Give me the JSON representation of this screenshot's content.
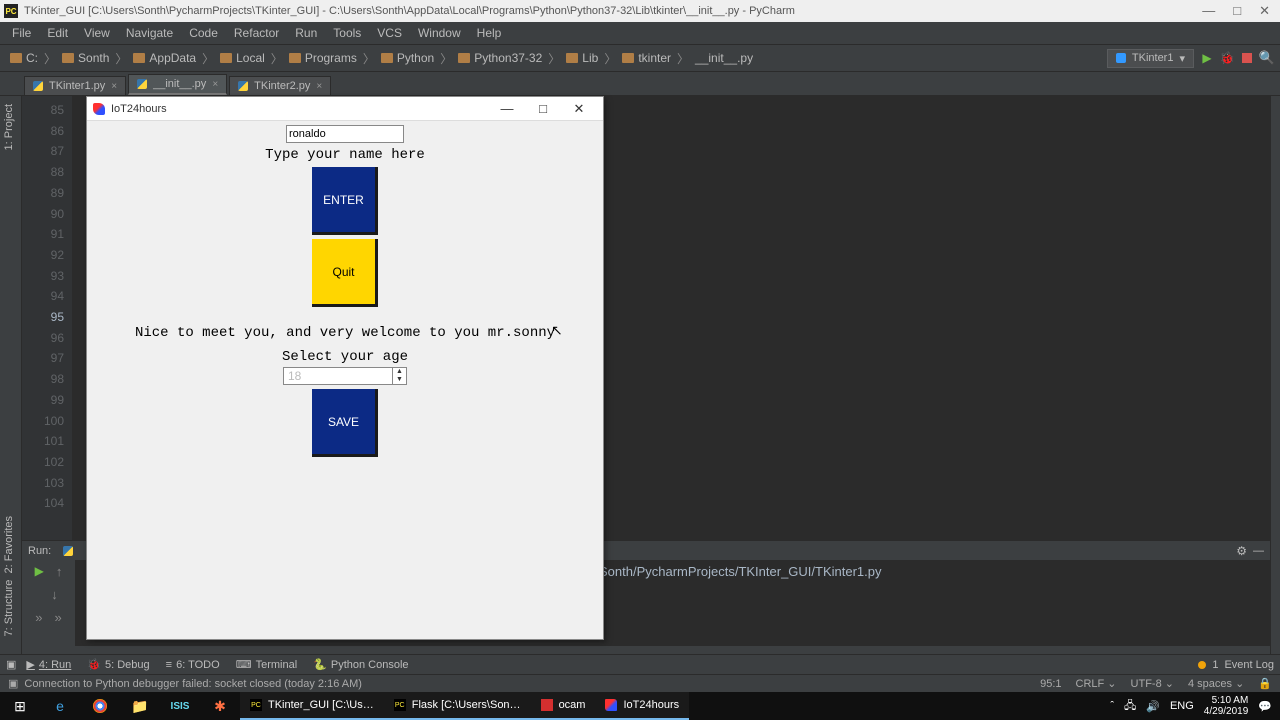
{
  "titlebar": {
    "text": "TKinter_GUI [C:\\Users\\Sonth\\PycharmProjects\\TKinter_GUI] - C:\\Users\\Sonth\\AppData\\Local\\Programs\\Python\\Python37-32\\Lib\\tkinter\\__init__.py - PyCharm"
  },
  "menu": [
    "File",
    "Edit",
    "View",
    "Navigate",
    "Code",
    "Refactor",
    "Run",
    "Tools",
    "VCS",
    "Window",
    "Help"
  ],
  "breadcrumbs": [
    "C:",
    "Sonth",
    "AppData",
    "Local",
    "Programs",
    "Python",
    "Python37-32",
    "Lib",
    "tkinter",
    "__init__.py"
  ],
  "run_config": "TKinter1",
  "tabs": [
    {
      "label": "TKinter1.py",
      "active": false
    },
    {
      "label": "__init__.py",
      "active": true
    },
    {
      "label": "TKinter2.py",
      "active": false
    }
  ],
  "gutter": {
    "start": 85,
    "end": 104,
    "current": 95
  },
  "run_panel": {
    "title": "Run:",
    "output": "\\python.exe C:/Users/Sonth/PycharmProjects/TKInter_GUI/TKinter1.py"
  },
  "tool_windows": {
    "items": [
      {
        "label": "4: Run",
        "active": true
      },
      {
        "label": "5: Debug",
        "active": false
      },
      {
        "label": "6: TODO",
        "active": false
      },
      {
        "label": "Terminal",
        "active": false
      },
      {
        "label": "Python Console",
        "active": false
      }
    ],
    "event_log": "Event Log",
    "badge": "1"
  },
  "statusbar": {
    "left": "Connection to Python debugger failed: socket closed (today 2:16 AM)",
    "pos": "95:1",
    "eol": "CRLF",
    "enc": "UTF-8",
    "spaces": "4 spaces"
  },
  "tk": {
    "title": "IoT24hours",
    "name_value": "ronaldo",
    "name_label": "Type your name here",
    "enter": "ENTER",
    "quit": "Quit",
    "welcome": "Nice to meet you, and very welcome to you mr.sonny",
    "age_label": "Select your age",
    "age_value": "18",
    "save": "SAVE"
  },
  "taskbar": {
    "tasks": [
      "TKinter_GUI [C:\\Us…",
      "Flask [C:\\Users\\Son…",
      "ocam",
      "IoT24hours"
    ],
    "lang": "ENG",
    "time": "5:10 AM",
    "date": "4/29/2019"
  }
}
